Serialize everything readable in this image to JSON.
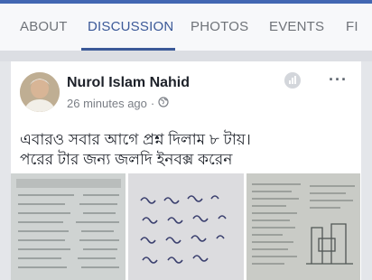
{
  "tabs": [
    "ABOUT",
    "DISCUSSION",
    "PHOTOS",
    "EVENTS",
    "FI"
  ],
  "active_tab": "DISCUSSION",
  "post": {
    "author": "Nurol Islam Nahid",
    "time": "26 minutes ago",
    "separator": "·",
    "privacy_icon": "globe-icon",
    "more_label": "···",
    "text_line1": "এবারও সবার আগে প্রশ্ন দিলাম ৮ টায়।",
    "text_line2": "পরের টার জন্য জলদি ইনবক্স করেন",
    "photo_count": 3
  },
  "colors": {
    "accent": "#3b5998",
    "tab_inactive": "#6f7379",
    "background": "#e4e6ea"
  }
}
